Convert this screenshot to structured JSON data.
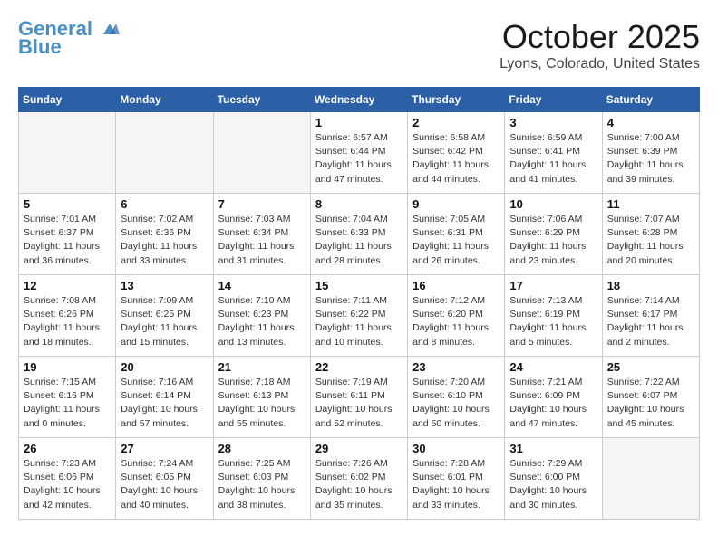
{
  "logo": {
    "line1": "General",
    "line2": "Blue"
  },
  "title": "October 2025",
  "subtitle": "Lyons, Colorado, United States",
  "days_of_week": [
    "Sunday",
    "Monday",
    "Tuesday",
    "Wednesday",
    "Thursday",
    "Friday",
    "Saturday"
  ],
  "weeks": [
    [
      {
        "day": "",
        "info": ""
      },
      {
        "day": "",
        "info": ""
      },
      {
        "day": "",
        "info": ""
      },
      {
        "day": "1",
        "info": "Sunrise: 6:57 AM\nSunset: 6:44 PM\nDaylight: 11 hours and 47 minutes."
      },
      {
        "day": "2",
        "info": "Sunrise: 6:58 AM\nSunset: 6:42 PM\nDaylight: 11 hours and 44 minutes."
      },
      {
        "day": "3",
        "info": "Sunrise: 6:59 AM\nSunset: 6:41 PM\nDaylight: 11 hours and 41 minutes."
      },
      {
        "day": "4",
        "info": "Sunrise: 7:00 AM\nSunset: 6:39 PM\nDaylight: 11 hours and 39 minutes."
      }
    ],
    [
      {
        "day": "5",
        "info": "Sunrise: 7:01 AM\nSunset: 6:37 PM\nDaylight: 11 hours and 36 minutes."
      },
      {
        "day": "6",
        "info": "Sunrise: 7:02 AM\nSunset: 6:36 PM\nDaylight: 11 hours and 33 minutes."
      },
      {
        "day": "7",
        "info": "Sunrise: 7:03 AM\nSunset: 6:34 PM\nDaylight: 11 hours and 31 minutes."
      },
      {
        "day": "8",
        "info": "Sunrise: 7:04 AM\nSunset: 6:33 PM\nDaylight: 11 hours and 28 minutes."
      },
      {
        "day": "9",
        "info": "Sunrise: 7:05 AM\nSunset: 6:31 PM\nDaylight: 11 hours and 26 minutes."
      },
      {
        "day": "10",
        "info": "Sunrise: 7:06 AM\nSunset: 6:29 PM\nDaylight: 11 hours and 23 minutes."
      },
      {
        "day": "11",
        "info": "Sunrise: 7:07 AM\nSunset: 6:28 PM\nDaylight: 11 hours and 20 minutes."
      }
    ],
    [
      {
        "day": "12",
        "info": "Sunrise: 7:08 AM\nSunset: 6:26 PM\nDaylight: 11 hours and 18 minutes."
      },
      {
        "day": "13",
        "info": "Sunrise: 7:09 AM\nSunset: 6:25 PM\nDaylight: 11 hours and 15 minutes."
      },
      {
        "day": "14",
        "info": "Sunrise: 7:10 AM\nSunset: 6:23 PM\nDaylight: 11 hours and 13 minutes."
      },
      {
        "day": "15",
        "info": "Sunrise: 7:11 AM\nSunset: 6:22 PM\nDaylight: 11 hours and 10 minutes."
      },
      {
        "day": "16",
        "info": "Sunrise: 7:12 AM\nSunset: 6:20 PM\nDaylight: 11 hours and 8 minutes."
      },
      {
        "day": "17",
        "info": "Sunrise: 7:13 AM\nSunset: 6:19 PM\nDaylight: 11 hours and 5 minutes."
      },
      {
        "day": "18",
        "info": "Sunrise: 7:14 AM\nSunset: 6:17 PM\nDaylight: 11 hours and 2 minutes."
      }
    ],
    [
      {
        "day": "19",
        "info": "Sunrise: 7:15 AM\nSunset: 6:16 PM\nDaylight: 11 hours and 0 minutes."
      },
      {
        "day": "20",
        "info": "Sunrise: 7:16 AM\nSunset: 6:14 PM\nDaylight: 10 hours and 57 minutes."
      },
      {
        "day": "21",
        "info": "Sunrise: 7:18 AM\nSunset: 6:13 PM\nDaylight: 10 hours and 55 minutes."
      },
      {
        "day": "22",
        "info": "Sunrise: 7:19 AM\nSunset: 6:11 PM\nDaylight: 10 hours and 52 minutes."
      },
      {
        "day": "23",
        "info": "Sunrise: 7:20 AM\nSunset: 6:10 PM\nDaylight: 10 hours and 50 minutes."
      },
      {
        "day": "24",
        "info": "Sunrise: 7:21 AM\nSunset: 6:09 PM\nDaylight: 10 hours and 47 minutes."
      },
      {
        "day": "25",
        "info": "Sunrise: 7:22 AM\nSunset: 6:07 PM\nDaylight: 10 hours and 45 minutes."
      }
    ],
    [
      {
        "day": "26",
        "info": "Sunrise: 7:23 AM\nSunset: 6:06 PM\nDaylight: 10 hours and 42 minutes."
      },
      {
        "day": "27",
        "info": "Sunrise: 7:24 AM\nSunset: 6:05 PM\nDaylight: 10 hours and 40 minutes."
      },
      {
        "day": "28",
        "info": "Sunrise: 7:25 AM\nSunset: 6:03 PM\nDaylight: 10 hours and 38 minutes."
      },
      {
        "day": "29",
        "info": "Sunrise: 7:26 AM\nSunset: 6:02 PM\nDaylight: 10 hours and 35 minutes."
      },
      {
        "day": "30",
        "info": "Sunrise: 7:28 AM\nSunset: 6:01 PM\nDaylight: 10 hours and 33 minutes."
      },
      {
        "day": "31",
        "info": "Sunrise: 7:29 AM\nSunset: 6:00 PM\nDaylight: 10 hours and 30 minutes."
      },
      {
        "day": "",
        "info": ""
      }
    ]
  ]
}
